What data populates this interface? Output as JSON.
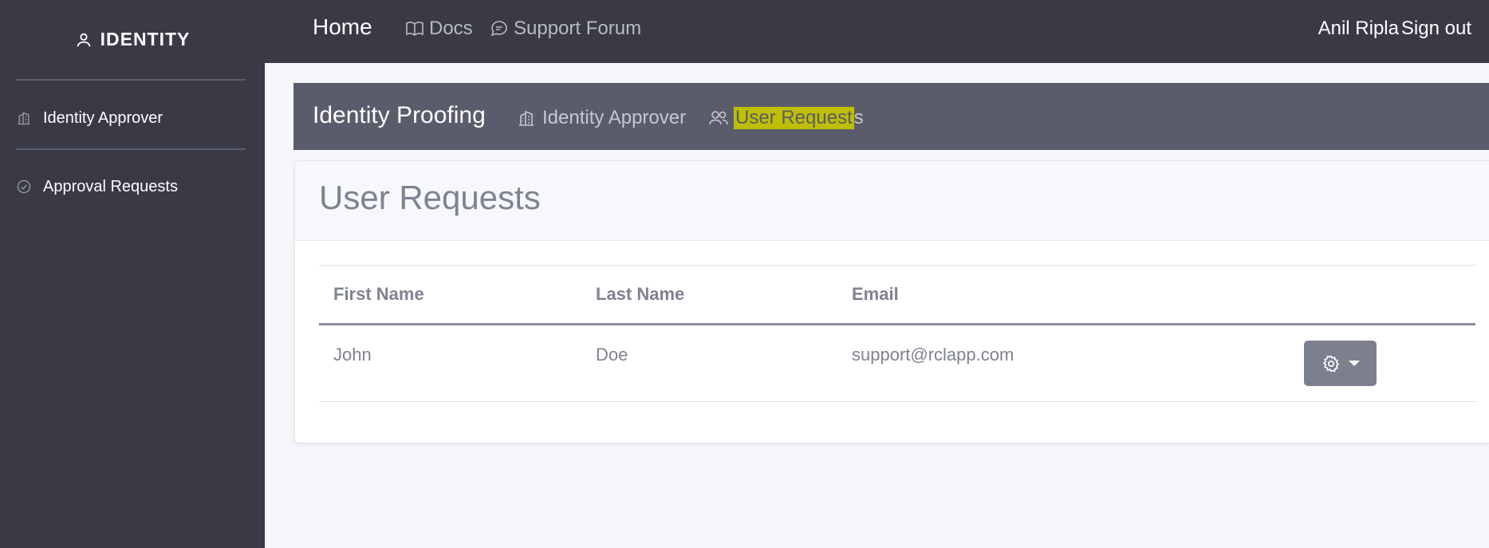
{
  "sidebar": {
    "brand": "IDENTITY",
    "brand_icon": "user-icon",
    "items": [
      {
        "label": "Identity Approver",
        "icon": "building-icon"
      },
      {
        "label": "Approval Requests",
        "icon": "check-circle-icon"
      }
    ]
  },
  "navbar": {
    "home": "Home",
    "links": [
      {
        "label": "Docs",
        "icon": "book-icon"
      },
      {
        "label": "Support Forum",
        "icon": "chat-icon"
      }
    ],
    "user": "Anil Ripla",
    "signout": "Sign out"
  },
  "subheader": {
    "title": "Identity Proofing",
    "links": [
      {
        "label": "Identity Approver",
        "icon": "building-icon"
      },
      {
        "label_highlighted": "User Request",
        "label_rest": "s",
        "icon": "users-icon"
      }
    ],
    "highlight_color": "#bfbf00"
  },
  "card": {
    "title": "User Requests",
    "table": {
      "headers": [
        "First Name",
        "Last Name",
        "Email"
      ],
      "rows": [
        {
          "first_name": "John",
          "last_name": "Doe",
          "email": "support@rclapp.com"
        }
      ]
    },
    "action_icon": "gear-icon"
  },
  "colors": {
    "sidebar_bg": "#393a46",
    "subheader_bg": "#5a5c6b",
    "button_bg": "#7c7f8e"
  }
}
